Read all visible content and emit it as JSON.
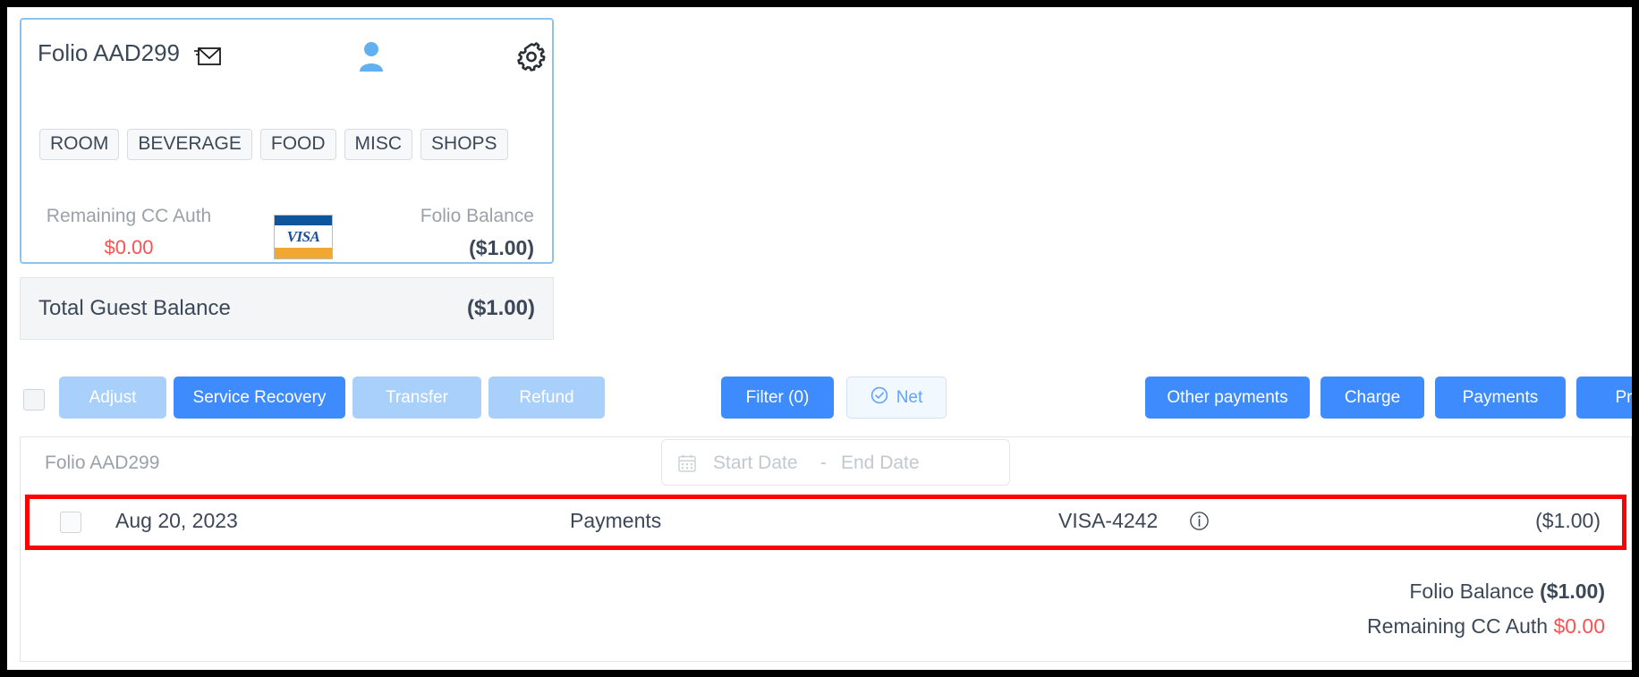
{
  "folio_card": {
    "title": "Folio AAD299",
    "icons": {
      "email": "envelope-icon",
      "guest": "person-icon",
      "settings": "gear-icon"
    },
    "chips": [
      "ROOM",
      "BEVERAGE",
      "FOOD",
      "MISC",
      "SHOPS"
    ],
    "remaining_cc_auth_label": "Remaining CC Auth",
    "remaining_cc_auth_value": "$0.00",
    "card_brand": "VISA",
    "folio_balance_label": "Folio Balance",
    "folio_balance_value": "($1.00)"
  },
  "total_guest_balance": {
    "label": "Total Guest Balance",
    "value": "($1.00)"
  },
  "toolbar": {
    "adjust": "Adjust",
    "service_recovery": "Service Recovery",
    "transfer": "Transfer",
    "refund": "Refund",
    "filter": "Filter (0)",
    "net": "Net",
    "other_payments": "Other payments",
    "charge": "Charge",
    "payments": "Payments",
    "print": "Print"
  },
  "list_header": {
    "folio_name": "Folio AAD299",
    "start_date_placeholder": "Start Date",
    "date_separator": "-",
    "end_date_placeholder": "End Date"
  },
  "transaction": {
    "date": "Aug 20, 2023",
    "type": "Payments",
    "card": "VISA-4242",
    "amount": "($1.00)"
  },
  "footer_totals": {
    "folio_balance_label": "Folio Balance",
    "folio_balance_value": "($1.00)",
    "remaining_cc_auth_label": "Remaining CC Auth",
    "remaining_cc_auth_value": "$0.00"
  },
  "colors": {
    "primary_blue": "#3d8bfd",
    "soft_blue": "#a9d0fb",
    "card_border": "#8cc4f0",
    "negative_red": "#fa5252",
    "highlight_red": "#ff0000",
    "text": "#3c4858",
    "muted": "#9aa1a9"
  }
}
